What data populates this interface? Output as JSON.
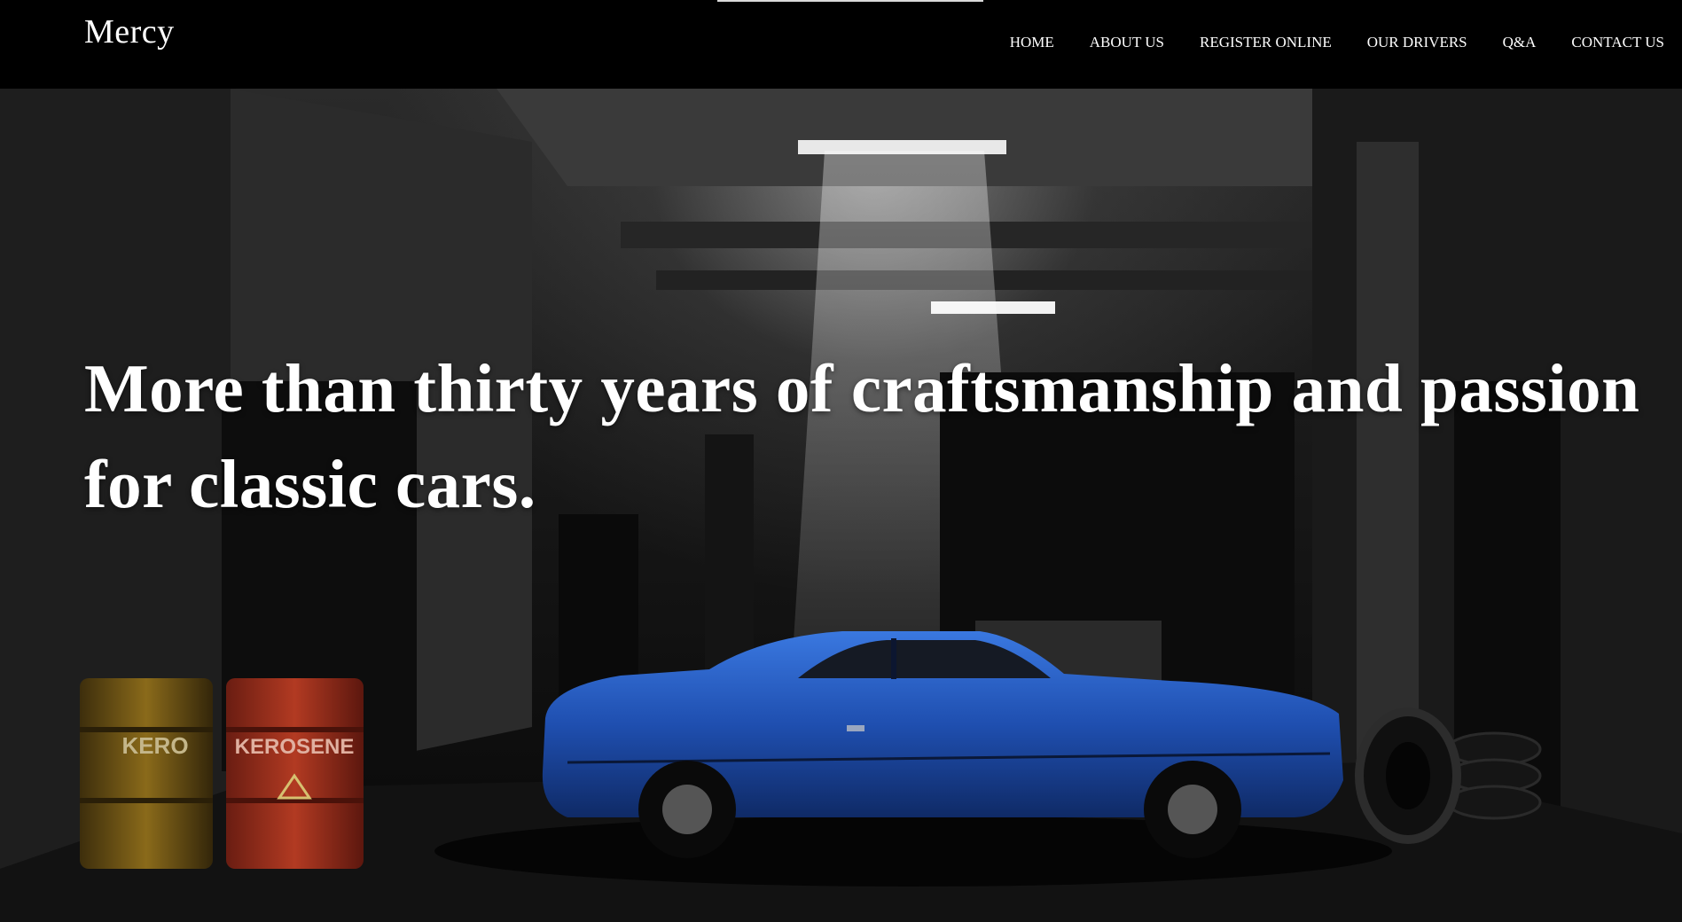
{
  "header": {
    "brand": "Mercy",
    "nav": [
      {
        "label": "HOME"
      },
      {
        "label": "ABOUT US"
      },
      {
        "label": "REGISTER ONLINE"
      },
      {
        "label": "OUR DRIVERS"
      },
      {
        "label": "Q&A"
      },
      {
        "label": "CONTACT US"
      }
    ]
  },
  "hero": {
    "headline": "More than thirty years of craftsmanship and passion for classic cars.",
    "image_description_icon": "garage-classic-car-image",
    "barrel_label": "KEROSENE",
    "barrel_label_partial": "KERO"
  },
  "colors": {
    "background": "#000000",
    "text": "#ffffff",
    "car_blue": "#1f4fb0",
    "barrel_red": "#a8321e",
    "barrel_yellow": "#8a6a1a"
  }
}
